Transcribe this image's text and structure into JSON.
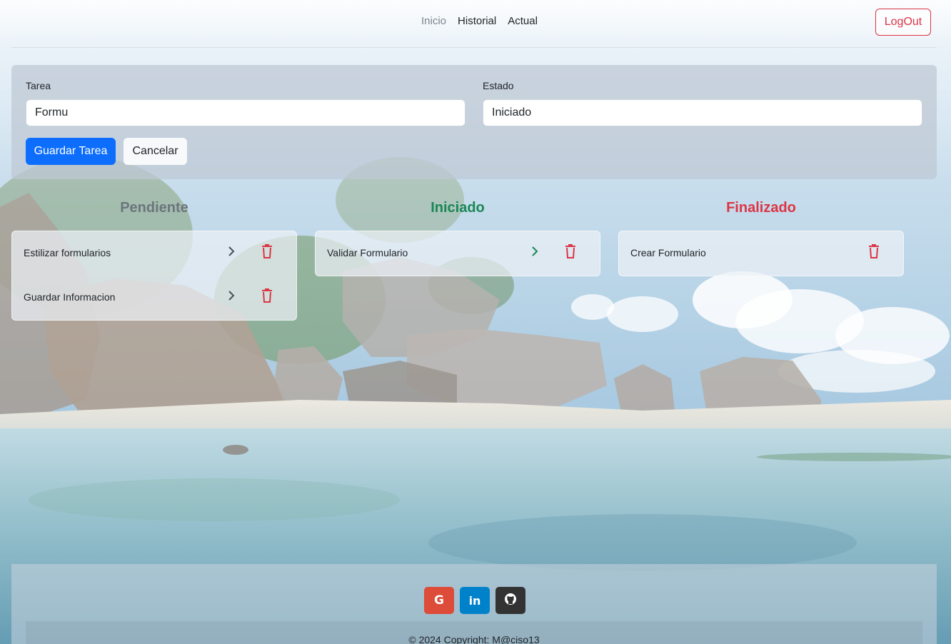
{
  "nav": {
    "links": [
      "Inicio",
      "Historial",
      "Actual"
    ],
    "active": "Inicio",
    "logout_label": "LogOut"
  },
  "form": {
    "task_label": "Tarea",
    "task_value": "Formu",
    "state_label": "Estado",
    "state_value": "Iniciado",
    "save_label": "Guardar Tarea",
    "cancel_label": "Cancelar"
  },
  "columns": [
    {
      "title": "Pendiente",
      "color": "#6c757d",
      "tasks": [
        "Estilizar formularios",
        "Guardar Informacion"
      ]
    },
    {
      "title": "Iniciado",
      "color": "#198754",
      "tasks": [
        "Validar Formulario"
      ]
    },
    {
      "title": "Finalizado",
      "color": "#dc3545",
      "tasks": [
        "Crear Formulario"
      ]
    }
  ],
  "icons": {
    "advance": "chevron-right-icon",
    "delete": "trash-icon",
    "social": [
      "google-icon",
      "linkedin-icon",
      "github-icon"
    ]
  },
  "footer": {
    "copyright": "© 2024 Copyright: M@ciso13"
  },
  "colors": {
    "primary": "#0d6efd",
    "danger": "#dc3545",
    "success": "#198754",
    "secondary": "#6c757d",
    "google": "#dd4b39",
    "linkedin": "#0082ca",
    "github": "#333333"
  }
}
